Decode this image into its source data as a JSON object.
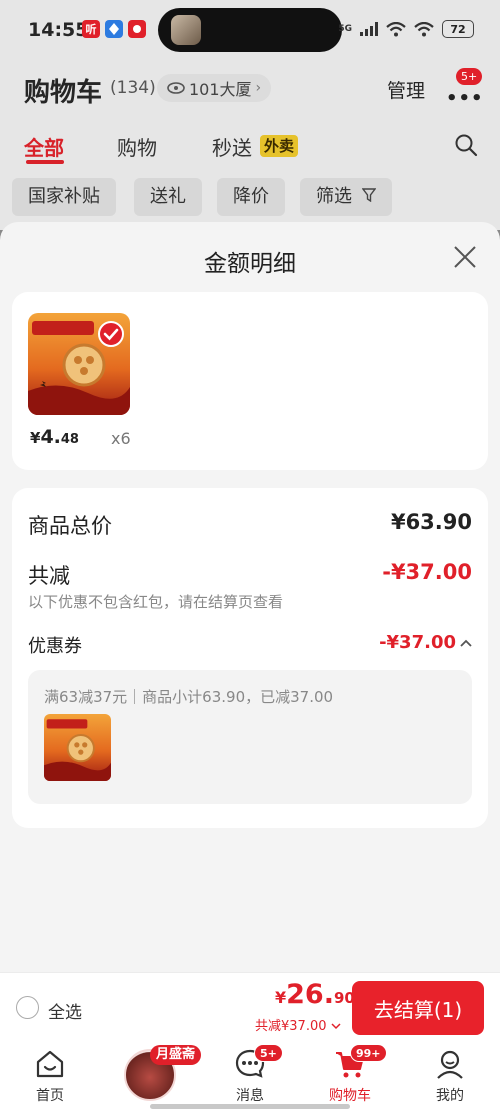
{
  "status_bar": {
    "time": "14:55",
    "apps": [
      {
        "icon": "ting-app-icon",
        "label": "听",
        "color": "#e0202a"
      },
      {
        "icon": "location-app-icon",
        "label": "",
        "color": "#2d7be0"
      },
      {
        "icon": "taobao-app-icon",
        "label": "",
        "color": "#e0202a"
      }
    ],
    "network": "5G",
    "battery": "72"
  },
  "header": {
    "title": "购物车",
    "count": "(134)",
    "location": "101大厦",
    "manage": "管理",
    "more_badge": "5+"
  },
  "tabs": [
    {
      "label": "全部",
      "active": true
    },
    {
      "label": "购物",
      "active": false
    },
    {
      "label": "秒送",
      "active": false,
      "badge": "外卖"
    }
  ],
  "filters": [
    "国家补贴",
    "送礼",
    "降价",
    "筛选"
  ],
  "sheet": {
    "title": "金额明细",
    "item": {
      "price_currency": "¥",
      "price_int": "4.",
      "price_dec": "48",
      "qty": "x6",
      "image_caption": "椒麻藕肉味"
    },
    "summary": {
      "total_label": "商品总价",
      "total_value": "¥63.90",
      "reduce_label": "共减",
      "reduce_value": "-¥37.00",
      "reduce_note": "以下优惠不包含红包，请在结算页查看",
      "coupon_label": "优惠券",
      "coupon_value": "-¥37.00",
      "coupon_desc": "满63减37元｜商品小计63.90，已减37.00"
    }
  },
  "checkout": {
    "select_all": "全选",
    "price_currency": "¥",
    "price_int": "26.",
    "price_dec": "90",
    "reduce": "共减¥37.00",
    "button": "去结算(1)"
  },
  "tabbar": {
    "items": [
      {
        "label": "首页",
        "icon": "home-icon"
      },
      {
        "label": "",
        "icon": "promo-meat-icon",
        "badge": "月盛斋"
      },
      {
        "label": "消息",
        "icon": "message-icon",
        "badge": "5+"
      },
      {
        "label": "购物车",
        "icon": "cart-icon",
        "badge": "99+",
        "active": true
      },
      {
        "label": "我的",
        "icon": "profile-icon"
      }
    ]
  },
  "colors": {
    "accent": "#e0202a",
    "sheet_bg": "#f4f4f4",
    "overlay": "#8a8a8a"
  }
}
